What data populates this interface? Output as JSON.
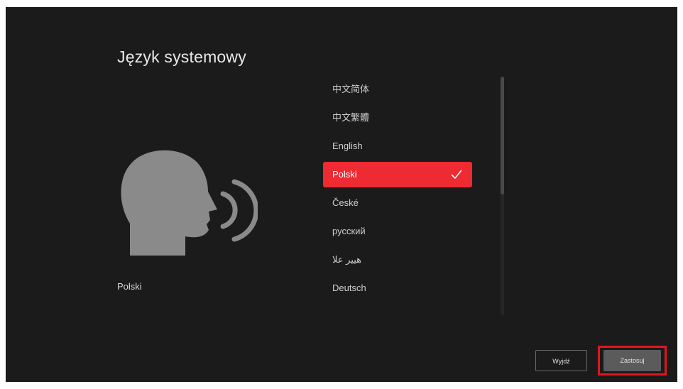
{
  "page": {
    "title": "Język systemowy",
    "current_language": "Polski"
  },
  "languages": {
    "items": [
      {
        "label": "中文简体",
        "selected": false
      },
      {
        "label": "中文繁體",
        "selected": false
      },
      {
        "label": "English",
        "selected": false
      },
      {
        "label": "Polski",
        "selected": true
      },
      {
        "label": "České",
        "selected": false
      },
      {
        "label": "русский",
        "selected": false
      },
      {
        "label": "هيير علا",
        "selected": false
      },
      {
        "label": "Deutsch",
        "selected": false
      }
    ]
  },
  "actions": {
    "exit_label": "Wyjdź",
    "apply_label": "Zastosuj"
  },
  "colors": {
    "background": "#1b1b1b",
    "accent": "#ee2a32",
    "highlight": "#e4141f",
    "illustration": "#8a8a8a"
  },
  "icons": {
    "illustration": "speaking-head-icon",
    "selected_marker": "check-icon"
  }
}
